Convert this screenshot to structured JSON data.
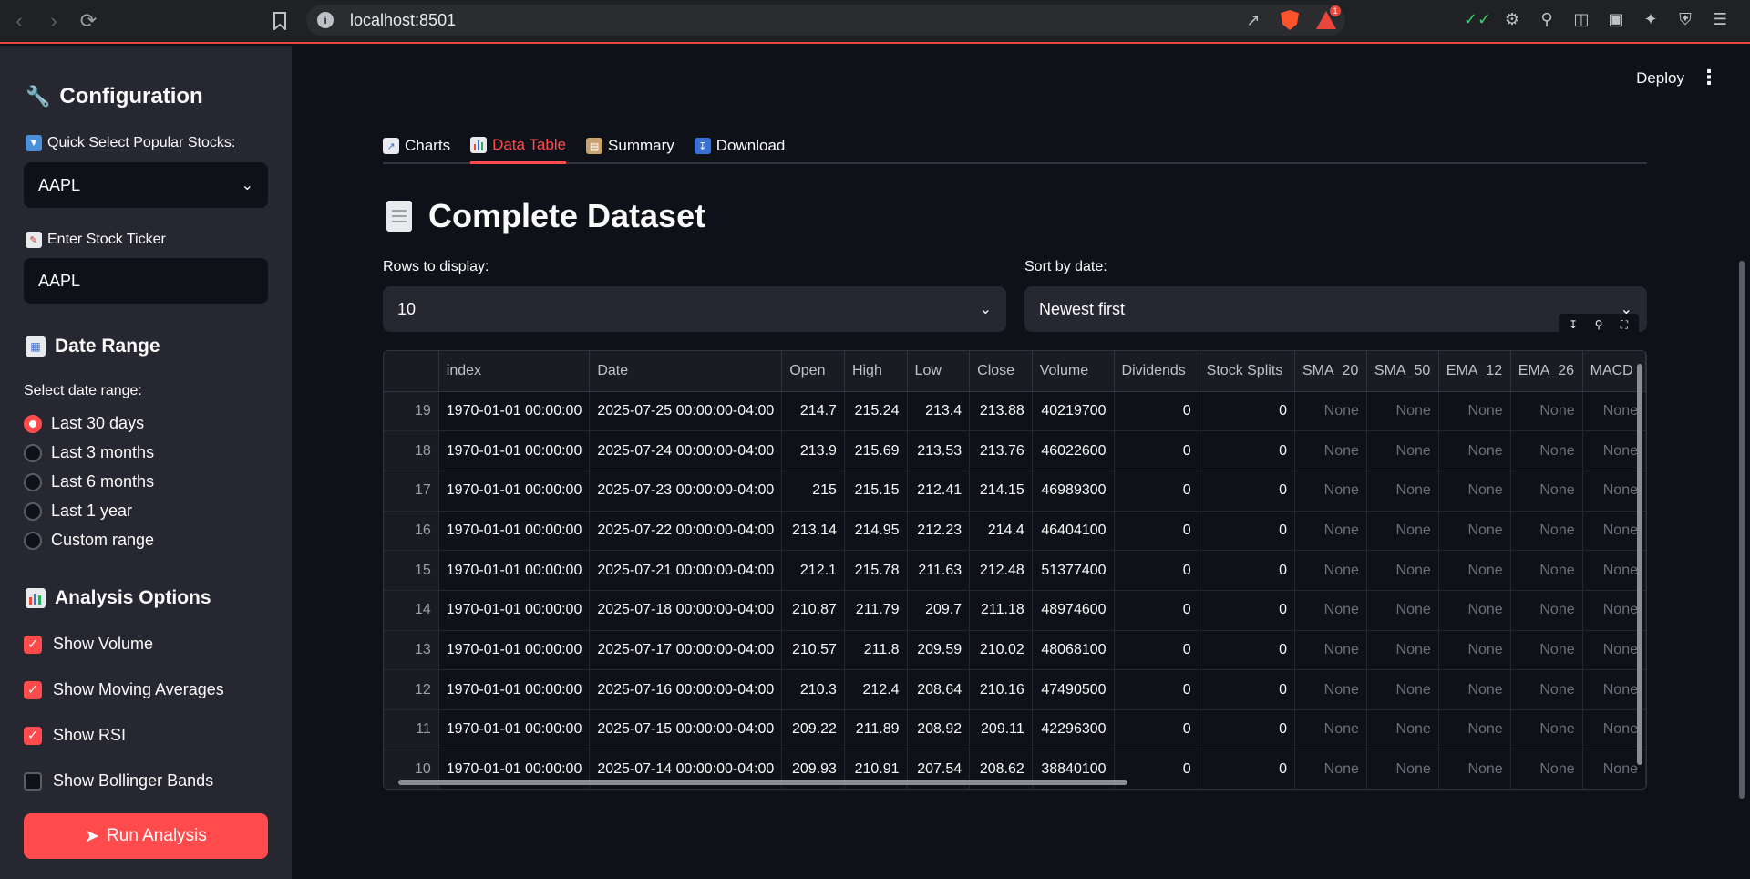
{
  "browser": {
    "url": "localhost:8501",
    "notification_count": "1"
  },
  "sidebar": {
    "config_title": "Configuration",
    "quick_select_label": "Quick Select Popular Stocks:",
    "quick_select_value": "AAPL",
    "ticker_label": "Enter Stock Ticker",
    "ticker_value": "AAPL",
    "date_range_title": "Date Range",
    "date_range_label": "Select date range:",
    "date_options": [
      "Last 30 days",
      "Last 3 months",
      "Last 6 months",
      "Last 1 year",
      "Custom range"
    ],
    "date_selected_index": 0,
    "analysis_title": "Analysis Options",
    "options": [
      {
        "label": "Show Volume",
        "checked": true
      },
      {
        "label": "Show Moving Averages",
        "checked": true
      },
      {
        "label": "Show RSI",
        "checked": true
      },
      {
        "label": "Show Bollinger Bands",
        "checked": false
      }
    ],
    "run_button": "Run Analysis"
  },
  "header": {
    "deploy": "Deploy"
  },
  "tabs": [
    {
      "label": "Charts",
      "active": false
    },
    {
      "label": "Data Table",
      "active": true
    },
    {
      "label": "Summary",
      "active": false
    },
    {
      "label": "Download",
      "active": false
    }
  ],
  "main": {
    "title": "Complete Dataset",
    "rows_label": "Rows to display:",
    "rows_value": "10",
    "sort_label": "Sort by date:",
    "sort_value": "Newest first"
  },
  "table": {
    "columns": [
      "",
      "index",
      "Date",
      "Open",
      "High",
      "Low",
      "Close",
      "Volume",
      "Dividends",
      "Stock Splits",
      "SMA_20",
      "SMA_50",
      "EMA_12",
      "EMA_26",
      "MACD"
    ],
    "rows": [
      [
        "19",
        "1970-01-01 00:00:00",
        "2025-07-25 00:00:00-04:00",
        "214.7",
        "215.24",
        "213.4",
        "213.88",
        "40219700",
        "0",
        "0",
        "None",
        "None",
        "None",
        "None",
        "None"
      ],
      [
        "18",
        "1970-01-01 00:00:00",
        "2025-07-24 00:00:00-04:00",
        "213.9",
        "215.69",
        "213.53",
        "213.76",
        "46022600",
        "0",
        "0",
        "None",
        "None",
        "None",
        "None",
        "None"
      ],
      [
        "17",
        "1970-01-01 00:00:00",
        "2025-07-23 00:00:00-04:00",
        "215",
        "215.15",
        "212.41",
        "214.15",
        "46989300",
        "0",
        "0",
        "None",
        "None",
        "None",
        "None",
        "None"
      ],
      [
        "16",
        "1970-01-01 00:00:00",
        "2025-07-22 00:00:00-04:00",
        "213.14",
        "214.95",
        "212.23",
        "214.4",
        "46404100",
        "0",
        "0",
        "None",
        "None",
        "None",
        "None",
        "None"
      ],
      [
        "15",
        "1970-01-01 00:00:00",
        "2025-07-21 00:00:00-04:00",
        "212.1",
        "215.78",
        "211.63",
        "212.48",
        "51377400",
        "0",
        "0",
        "None",
        "None",
        "None",
        "None",
        "None"
      ],
      [
        "14",
        "1970-01-01 00:00:00",
        "2025-07-18 00:00:00-04:00",
        "210.87",
        "211.79",
        "209.7",
        "211.18",
        "48974600",
        "0",
        "0",
        "None",
        "None",
        "None",
        "None",
        "None"
      ],
      [
        "13",
        "1970-01-01 00:00:00",
        "2025-07-17 00:00:00-04:00",
        "210.57",
        "211.8",
        "209.59",
        "210.02",
        "48068100",
        "0",
        "0",
        "None",
        "None",
        "None",
        "None",
        "None"
      ],
      [
        "12",
        "1970-01-01 00:00:00",
        "2025-07-16 00:00:00-04:00",
        "210.3",
        "212.4",
        "208.64",
        "210.16",
        "47490500",
        "0",
        "0",
        "None",
        "None",
        "None",
        "None",
        "None"
      ],
      [
        "11",
        "1970-01-01 00:00:00",
        "2025-07-15 00:00:00-04:00",
        "209.22",
        "211.89",
        "208.92",
        "209.11",
        "42296300",
        "0",
        "0",
        "None",
        "None",
        "None",
        "None",
        "None"
      ],
      [
        "10",
        "1970-01-01 00:00:00",
        "2025-07-14 00:00:00-04:00",
        "209.93",
        "210.91",
        "207.54",
        "208.62",
        "38840100",
        "0",
        "0",
        "None",
        "None",
        "None",
        "None",
        "None"
      ]
    ]
  },
  "colors": {
    "accent": "#ff4b4b",
    "sidebar_bg": "#262730",
    "main_bg": "#0e1117"
  }
}
